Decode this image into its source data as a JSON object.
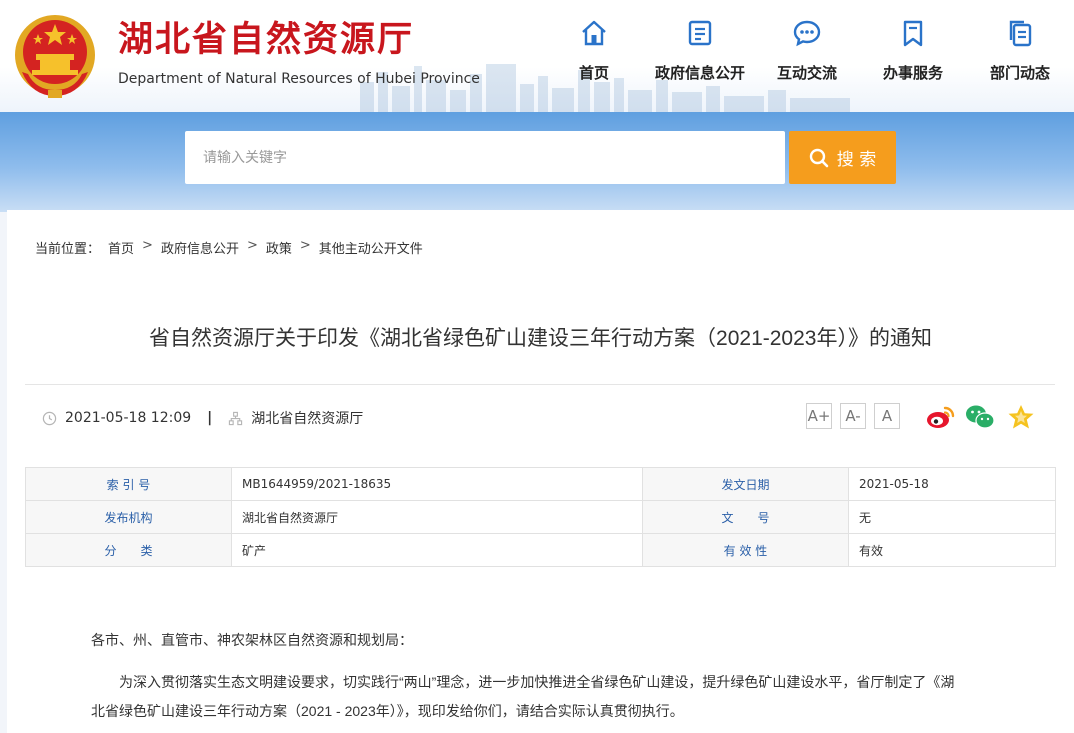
{
  "header": {
    "title": "湖北省自然资源厅",
    "subtitle": "Department of Natural Resources of Hubei Province",
    "nav": [
      {
        "label": "首页",
        "icon": "home-icon"
      },
      {
        "label": "政府信息公开",
        "icon": "document-icon"
      },
      {
        "label": "互动交流",
        "icon": "chat-bubble-icon"
      },
      {
        "label": "办事服务",
        "icon": "bookmark-icon"
      },
      {
        "label": "部门动态",
        "icon": "pages-icon"
      }
    ],
    "accent_color": "#c8161d",
    "nav_icon_color": "#2a73c9"
  },
  "search": {
    "placeholder": "请输入关键字",
    "button_label": "搜 索",
    "button_color": "#f59d1d"
  },
  "breadcrumb": {
    "prefix": "当前位置：",
    "items": [
      "首页",
      "政府信息公开",
      "政策",
      "其他主动公开文件"
    ],
    "separator": ">"
  },
  "article": {
    "title": "省自然资源厅关于印发《湖北省绿色矿山建设三年行动方案（2021-2023年）》的通知",
    "datetime": "2021-05-18 12:09",
    "meta_separator": "|",
    "publisher": "湖北省自然资源厅",
    "font_sizes": [
      "A+",
      "A-",
      "A"
    ]
  },
  "info_table": [
    {
      "k1": "索 引 号",
      "v1": "MB1644959/2021-18635",
      "k2": "发文日期",
      "v2": "2021-05-18"
    },
    {
      "k1": "发布机构",
      "v1": "湖北省自然资源厅",
      "k2": "文　　号",
      "v2": "无"
    },
    {
      "k1": "分　　类",
      "v1": "矿产",
      "k2": "有 效 性",
      "v2": "有效"
    }
  ],
  "body": {
    "salutation": "各市、州、直管市、神农架林区自然资源和规划局：",
    "paragraph1_line1": "为深入贯彻落实生态文明建设要求，切实践行“两山”理念，进一步加快推进全省绿色矿山建设，提升绿色矿山建设水平，省厅制定了《湖",
    "paragraph1_line2": "北省绿色矿山建设三年行动方案（2021 - 2023年）》，现印发给你们，请结合实际认真贯彻执行。"
  }
}
